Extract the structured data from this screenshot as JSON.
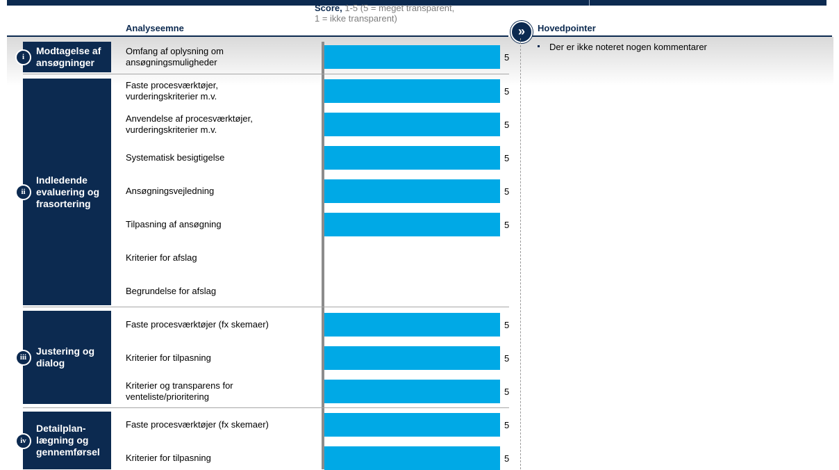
{
  "header": {
    "topic_label": "Analyseemne",
    "score_label_bold": "Score,",
    "score_label_rest": " 1-5 (5 = meget transparent,",
    "score_label_line2": "1 = ikke transparent)",
    "main_points_label": "Hovedpointer",
    "chevron_icon": "double-chevron-right-icon"
  },
  "stages": [
    {
      "badge": "i",
      "name": "Modtagelse af ansøgninger"
    },
    {
      "badge": "ii",
      "name": "Indledende evaluering og frasortering"
    },
    {
      "badge": "iii",
      "name": "Justering og dialog"
    },
    {
      "badge": "iv",
      "name": "Detailplan-lægning og gennemførsel"
    }
  ],
  "topics": [
    "Omfang af oplysning om ansøgningsmuligheder",
    "Faste procesværktøjer, vurderingskriterier m.v.",
    "Anvendelse af procesværktøjer, vurderingskriterier m.v.",
    "Systematisk besigtigelse",
    "Ansøgningsvejledning",
    "Tilpasning af ansøgning",
    "Kriterier for afslag",
    "Begrundelse for afslag",
    "Faste procesværktøjer (fx skemaer)",
    "Kriterier for tilpasning",
    "Kriterier og transparens for venteliste/prioritering",
    "Faste procesværktøjer (fx skemaer)",
    "Kriterier for tilpasning"
  ],
  "main_points": [
    "Der er ikke noteret nogen kommentarer"
  ],
  "colors": {
    "navy": "#0c2a50",
    "bar": "#00a9e6"
  },
  "chart_data": {
    "type": "bar",
    "orientation": "horizontal",
    "categories": [
      "Omfang af oplysning om ansøgningsmuligheder",
      "Faste procesværktøjer, vurderingskriterier m.v.",
      "Anvendelse af procesværktøjer, vurderingskriterier m.v.",
      "Systematisk besigtigelse",
      "Ansøgningsvejledning",
      "Tilpasning af ansøgning",
      "Kriterier for afslag",
      "Begrundelse for afslag",
      "Faste procesværktøjer (fx skemaer)",
      "Kriterier for tilpasning",
      "Kriterier og transparens for venteliste/prioritering",
      "Faste procesværktøjer (fx skemaer)",
      "Kriterier for tilpasning"
    ],
    "values": [
      5,
      5,
      5,
      5,
      5,
      5,
      null,
      null,
      5,
      5,
      5,
      5,
      5
    ],
    "xlim": [
      0,
      5
    ]
  }
}
